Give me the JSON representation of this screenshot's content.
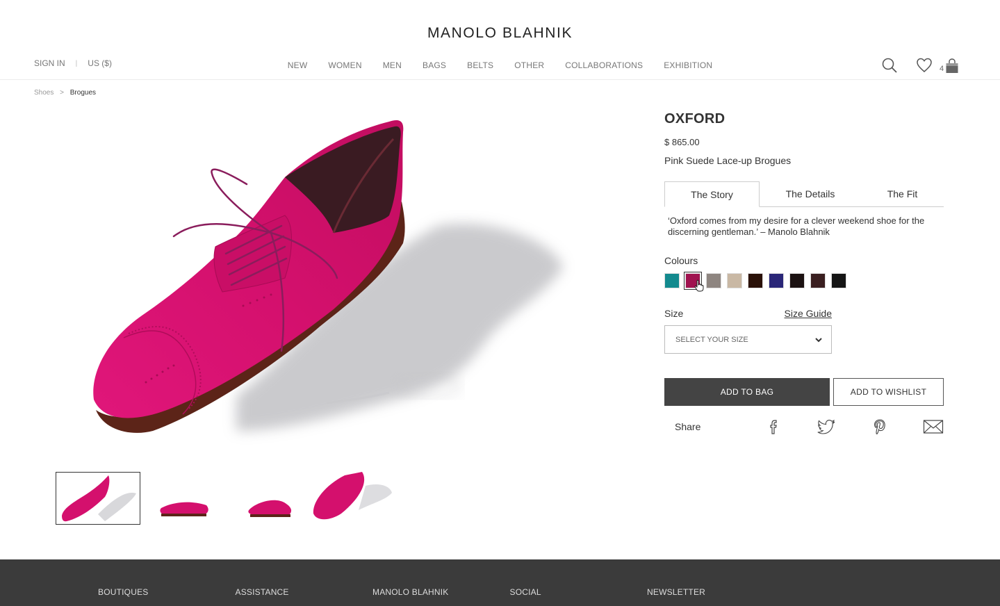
{
  "brand": "MANOLO BLAHNIK",
  "account": {
    "sign_in": "SIGN IN",
    "separator": "|",
    "region": "US ($)"
  },
  "nav": [
    "NEW",
    "WOMEN",
    "MEN",
    "BAGS",
    "BELTS",
    "OTHER",
    "COLLABORATIONS",
    "EXHIBITION"
  ],
  "cart_count": "4",
  "breadcrumb": {
    "parent": "Shoes",
    "separator": ">",
    "current": "Brogues"
  },
  "product": {
    "title": "OXFORD",
    "price": "$ 865.00",
    "subtitle": "Pink Suede Lace-up Brogues",
    "tabs": [
      "The Story",
      "The Details",
      "The Fit"
    ],
    "active_tab": "The Story",
    "story": "‘Oxford comes from my desire for a clever weekend shoe for the discerning gentleman.’ – Manolo Blahnik",
    "colours_label": "Colours",
    "swatches": [
      {
        "color": "#138a8e"
      },
      {
        "color": "#a0124f",
        "selected": true
      },
      {
        "color": "#8e8580"
      },
      {
        "color": "#c9b8a4"
      },
      {
        "color": "#2a1108"
      },
      {
        "color": "#2a2678"
      },
      {
        "color": "#1c1212"
      },
      {
        "color": "#3a1f20"
      },
      {
        "color": "#151515"
      }
    ],
    "size_label": "Size",
    "size_guide": "Size Guide",
    "size_placeholder": "SELECT YOUR SIZE",
    "add_to_bag": "ADD TO BAG",
    "add_to_wishlist": "ADD TO WISHLIST",
    "share_label": "Share"
  },
  "colors": {
    "product_pink": "#d6126f",
    "footer_bg": "#3b3b3b",
    "button_bg": "#444444"
  },
  "footer": [
    "BOUTIQUES",
    "ASSISTANCE",
    "MANOLO BLAHNIK",
    "SOCIAL",
    "NEWSLETTER"
  ]
}
